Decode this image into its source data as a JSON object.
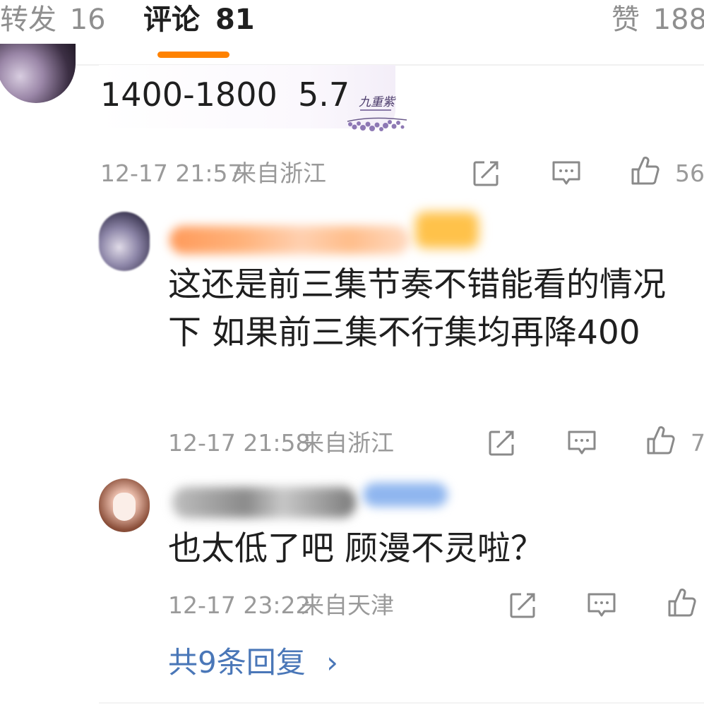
{
  "tabs": [
    {
      "label": "转发",
      "count": "16"
    },
    {
      "label": "评论",
      "count": "81"
    },
    {
      "label": "赞",
      "count": "188"
    }
  ],
  "top_comment": {
    "text": "1400-1800  5.7",
    "stamp_text": "九重紫",
    "time": "12-17 21:57",
    "location": "来自浙江",
    "likes": "56"
  },
  "replies": [
    {
      "text": "这还是前三集节奏不错能看的情况下 如果前三集不行集均再降400",
      "time": "12-17 21:58",
      "location": "来自浙江",
      "likes": "7"
    },
    {
      "text": "也太低了吧 顾漫不灵啦？",
      "time": "12-17 23:22",
      "location": "来自天津",
      "likes": ""
    }
  ],
  "more_replies": "共9条回复",
  "more_chevron": "›",
  "icons": [
    "share-icon",
    "comment-icon",
    "like-icon",
    "chevron-right-icon"
  ],
  "colors": {
    "accent": "#ff8200",
    "link": "#4a77b8",
    "meta": "#9a9a9a"
  }
}
